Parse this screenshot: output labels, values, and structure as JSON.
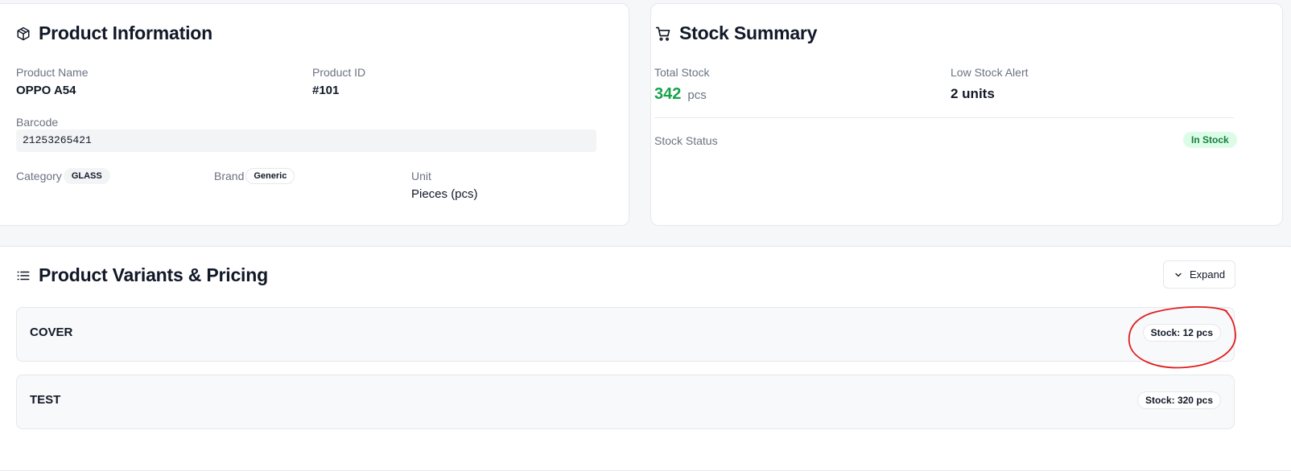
{
  "product_info": {
    "title": "Product Information",
    "icon": "package-icon",
    "product_name_label": "Product Name",
    "product_name": "OPPO A54",
    "product_id_label": "Product ID",
    "product_id": "#101",
    "barcode_label": "Barcode",
    "barcode": "21253265421",
    "category_label": "Category",
    "category": "GLASS",
    "brand_label": "Brand",
    "brand": "Generic",
    "unit_label": "Unit",
    "unit": "Pieces (pcs)"
  },
  "stock_summary": {
    "title": "Stock Summary",
    "icon": "cart-icon",
    "total_stock_label": "Total Stock",
    "total_stock": "342",
    "total_stock_unit": "pcs",
    "low_stock_label": "Low Stock Alert",
    "low_stock": "2 units",
    "status_label": "Stock Status",
    "status": "In Stock",
    "accent_color": "#16a34a"
  },
  "variants": {
    "title": "Product Variants & Pricing",
    "icon": "list-icon",
    "expand_label": "Expand",
    "items": [
      {
        "name": "COVER",
        "stock": "Stock: 12 pcs"
      },
      {
        "name": "TEST",
        "stock": "Stock: 320 pcs"
      }
    ],
    "annotation_color": "#e11d1d"
  }
}
